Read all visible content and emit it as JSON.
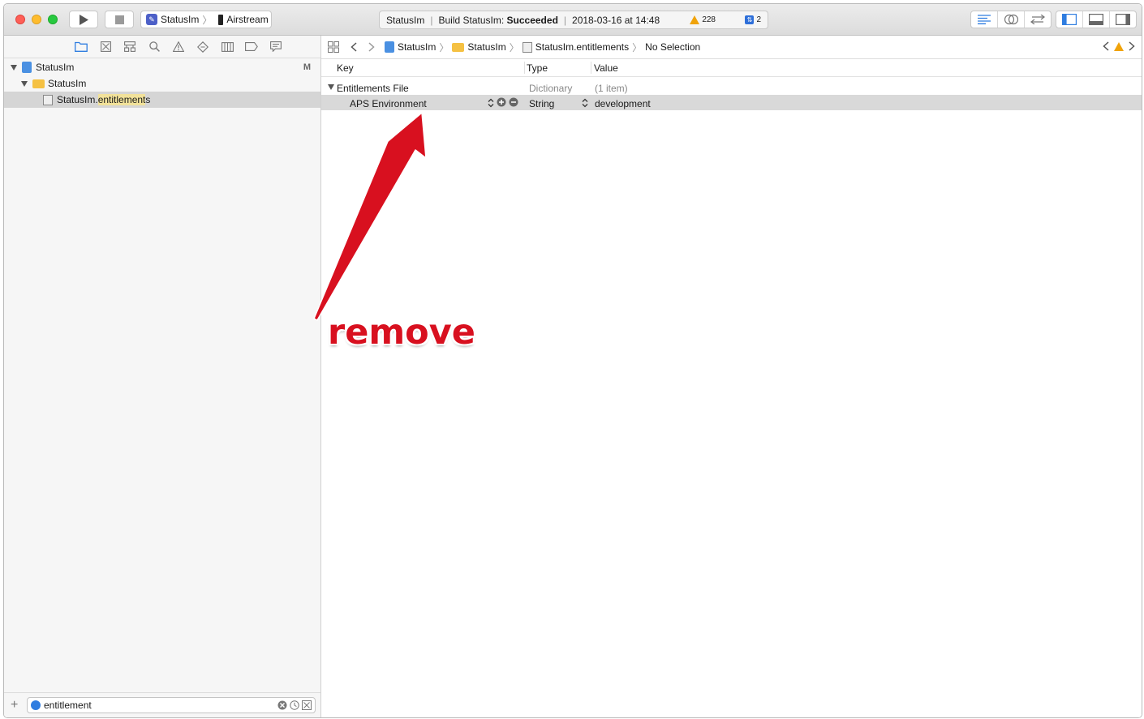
{
  "toolbar": {
    "scheme_app": "StatusIm",
    "scheme_device": "Airstream",
    "activity_project": "StatusIm",
    "activity_build_prefix": "Build StatusIm:",
    "activity_build_status": "Succeeded",
    "activity_timestamp": "2018-03-16 at 14:48",
    "warning_count": "228",
    "issue_count": "2"
  },
  "navigator": {
    "tabs": [
      "folder-icon",
      "source-control-icon",
      "symbol-icon",
      "find-icon",
      "issue-icon",
      "test-icon",
      "debug-icon",
      "breakpoint-icon",
      "report-icon"
    ],
    "tree": [
      {
        "label": "StatusIm",
        "badge": "M"
      },
      {
        "label": "StatusIm"
      },
      {
        "label_prefix": "StatusIm.",
        "label_highlight": "entitlement",
        "label_suffix": "s"
      }
    ],
    "filter_value": "entitlement"
  },
  "editor": {
    "breadcrumb": [
      "StatusIm",
      "StatusIm",
      "StatusIm.entitlements",
      "No Selection"
    ],
    "columns": {
      "key": "Key",
      "type": "Type",
      "value": "Value"
    },
    "rows": [
      {
        "key": "Entitlements File",
        "type": "Dictionary",
        "value": "(1 item)"
      },
      {
        "key": "APS Environment",
        "type": "String",
        "value": "development"
      }
    ]
  },
  "annotation": {
    "text": "remove",
    "color": "#d8101f"
  },
  "colors": {
    "accent": "#2f7de0",
    "warning": "#f0a30a",
    "selection": "#d5d5d5"
  }
}
